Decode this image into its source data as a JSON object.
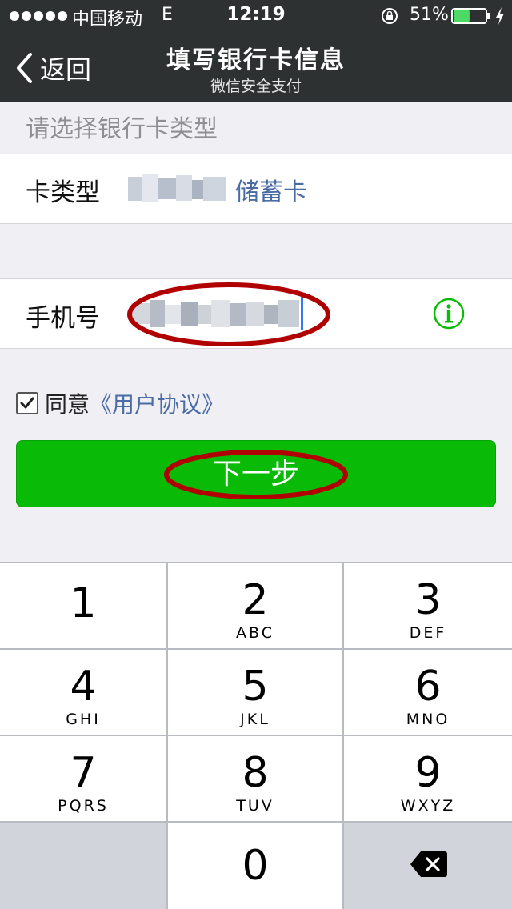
{
  "status_bar": {
    "carrier": "中国移动",
    "network": "E",
    "time": "12:19",
    "battery_percent": "51%",
    "battery_level": 0.51,
    "icons": [
      "signal-dots",
      "rotation-lock-icon",
      "battery-icon",
      "charging-bolt-icon"
    ]
  },
  "nav": {
    "back_label": "返回",
    "title": "填写银行卡信息",
    "subtitle": "微信安全支付"
  },
  "form": {
    "section_header": "请选择银行卡类型",
    "card_type_label": "卡类型",
    "card_type_value": "储蓄卡",
    "phone_label": "手机号"
  },
  "agreement": {
    "checked": true,
    "prefix": "同意",
    "link": "《用户协议》"
  },
  "next_button": "下一步",
  "keypad": {
    "keys": [
      {
        "digit": "1",
        "letters": ""
      },
      {
        "digit": "2",
        "letters": "ABC"
      },
      {
        "digit": "3",
        "letters": "DEF"
      },
      {
        "digit": "4",
        "letters": "GHI"
      },
      {
        "digit": "5",
        "letters": "JKL"
      },
      {
        "digit": "6",
        "letters": "MNO"
      },
      {
        "digit": "7",
        "letters": "PQRS"
      },
      {
        "digit": "8",
        "letters": "TUV"
      },
      {
        "digit": "9",
        "letters": "WXYZ"
      },
      {
        "digit": "0",
        "letters": ""
      }
    ]
  },
  "colors": {
    "nav_background": "#2e3132",
    "primary_button": "#09bb07",
    "link": "#4a6ba4",
    "annotation_red": "#b00000"
  }
}
